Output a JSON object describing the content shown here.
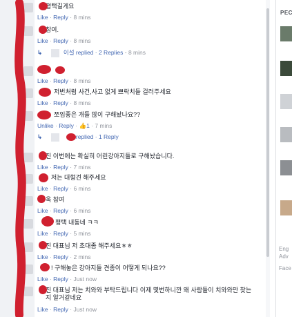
{
  "sidebar": {
    "title": "PEC",
    "footer": [
      "Eng",
      "Adv",
      "Face"
    ]
  },
  "comments": [
    {
      "text": "평택길게요",
      "actions": [
        "Like",
        "Reply"
      ],
      "time": "8 mins"
    },
    {
      "text": "참여.",
      "actions": [
        "Like",
        "Reply"
      ],
      "time": "8 mins",
      "replies": {
        "author": "이설",
        "label": "replied · 2 Replies",
        "time": "8 mins"
      }
    },
    {
      "text": "",
      "actions": [
        "Like",
        "Reply"
      ],
      "time": "8 mins"
    },
    {
      "text": "저번처럼 사건,사고 없게 쁘락치들 걸러주세요",
      "actions": [
        "Like",
        "Reply"
      ],
      "time": "8 mins"
    },
    {
      "text": "쪼임좋은 개들 많이 구해놨나요??",
      "actions": [
        "Unlike",
        "Reply"
      ],
      "likes": "1",
      "time": "7 mins",
      "replies": {
        "author": "",
        "label": "replied · 1 Reply",
        "time": ""
      }
    },
    {
      "text": "진 이번에는 확실히 어린강아지들로 구해놨습니다.",
      "actions": [
        "Like",
        "Reply"
      ],
      "time": "7 mins"
    },
    {
      "text": "저는 대형견 해주세요",
      "actions": [
        "Like",
        "Reply"
      ],
      "time": "6 mins"
    },
    {
      "text": "욱 참여",
      "actions": [
        "Like",
        "Reply"
      ],
      "time": "6 mins"
    },
    {
      "text": "평택 내동네 ㅋㅋ",
      "actions": [
        "Like",
        "Reply"
      ],
      "time": "5 mins"
    },
    {
      "text": "진 대표님 저 초대좀 해주세요ㅎㅎ",
      "actions": [
        "Like",
        "Reply"
      ],
      "time": "2 mins"
    },
    {
      "text": "! 구해놓은 강아지들 견종이 어떻게 되나요??",
      "actions": [
        "Like",
        "Reply"
      ],
      "time": "Just now"
    },
    {
      "text": "진 대표님 저는 치와와 부탁드립니다 이제 몇번하니깐 왜 사람들이 치와와만 찾는지 알거같네요",
      "actions": [
        "Like",
        "Reply"
      ],
      "time": "Just now"
    }
  ]
}
